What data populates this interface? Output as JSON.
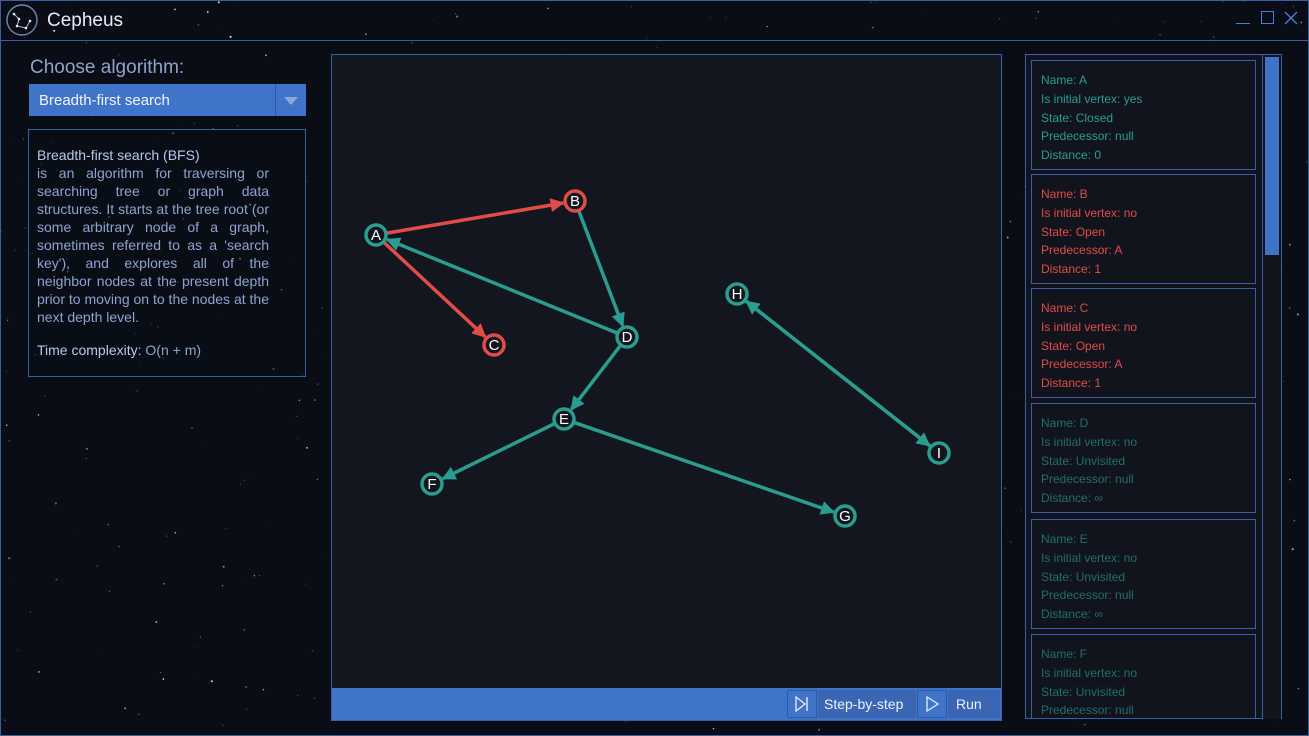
{
  "app": {
    "title": "Cepheus"
  },
  "colors": {
    "accent": "#3f74c9",
    "border": "#3a5ea8",
    "visited": "#2a9d8f",
    "open": "#e04c48",
    "closed_text": "#2a9d8f",
    "unvisited_text": "#1f6f68"
  },
  "sidebar": {
    "choose_label": "Choose algorithm:",
    "selected_algorithm": "Breadth-first search",
    "description_title": "Breadth-first search (BFS)",
    "description_body": "is an algorithm for traversing or searching tree or graph data structures. It starts at the tree root (or some arbitrary node of a graph, sometimes referred to as a 'search key'), and explores all of the neighbor nodes at the present depth prior to moving on to the nodes at the next depth level.",
    "complexity_label": "Time complexity:",
    "complexity_value": "O(n + m)"
  },
  "graph": {
    "nodes": [
      {
        "id": "A",
        "state": "visited"
      },
      {
        "id": "B",
        "state": "open"
      },
      {
        "id": "C",
        "state": "open"
      },
      {
        "id": "D",
        "state": "visited"
      },
      {
        "id": "E",
        "state": "visited"
      },
      {
        "id": "F",
        "state": "visited"
      },
      {
        "id": "G",
        "state": "visited"
      },
      {
        "id": "H",
        "state": "visited"
      },
      {
        "id": "I",
        "state": "visited"
      }
    ],
    "edges": [
      {
        "from": "A",
        "to": "B",
        "state": "open"
      },
      {
        "from": "A",
        "to": "C",
        "state": "open"
      },
      {
        "from": "B",
        "to": "D",
        "state": "normal"
      },
      {
        "from": "D",
        "to": "A",
        "state": "normal"
      },
      {
        "from": "D",
        "to": "E",
        "state": "normal"
      },
      {
        "from": "E",
        "to": "F",
        "state": "normal"
      },
      {
        "from": "E",
        "to": "G",
        "state": "normal"
      },
      {
        "from": "I",
        "to": "H",
        "state": "normal"
      },
      {
        "from": "H",
        "to": "I",
        "state": "normal"
      }
    ]
  },
  "controls": {
    "step_label": "Step-by-step",
    "run_label": "Run",
    "step_icon": "skip-forward-icon",
    "run_icon": "play-icon"
  },
  "vertices": [
    {
      "name": "Name: A",
      "initial": "Is initial vertex: yes",
      "state": "State: Closed",
      "pred": "Predecessor: null",
      "dist": "Distance: 0",
      "status": "closed"
    },
    {
      "name": "Name: B",
      "initial": "Is initial vertex: no",
      "state": "State: Open",
      "pred": "Predecessor: A",
      "dist": "Distance: 1",
      "status": "open"
    },
    {
      "name": "Name: C",
      "initial": "Is initial vertex: no",
      "state": "State: Open",
      "pred": "Predecessor: A",
      "dist": "Distance: 1",
      "status": "open"
    },
    {
      "name": "Name: D",
      "initial": "Is initial vertex: no",
      "state": "State: Unvisited",
      "pred": "Predecessor: null",
      "dist": "Distance: ∞",
      "status": "unvisited"
    },
    {
      "name": "Name: E",
      "initial": "Is initial vertex: no",
      "state": "State: Unvisited",
      "pred": "Predecessor: null",
      "dist": "Distance: ∞",
      "status": "unvisited"
    },
    {
      "name": "Name: F",
      "initial": "Is initial vertex: no",
      "state": "State: Unvisited",
      "pred": "Predecessor: null",
      "dist": "",
      "status": "unvisited"
    }
  ]
}
